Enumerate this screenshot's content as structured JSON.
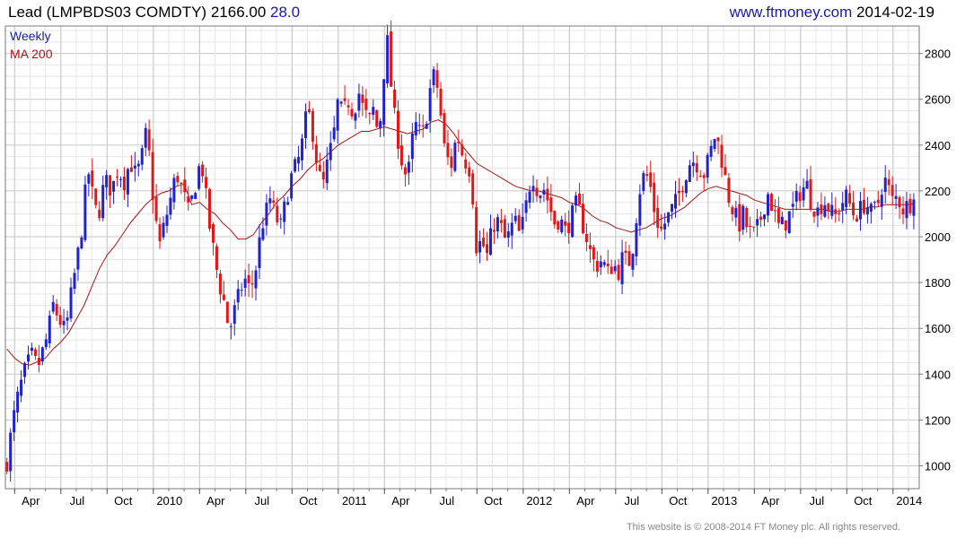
{
  "header": {
    "name": "Lead",
    "ticker": "(LMPBDS03 COMDTY)",
    "last": "2166.00",
    "change": "28.0",
    "site": "www.ftmoney.com",
    "date": "2014-02-19"
  },
  "legend": {
    "period": "Weekly",
    "ma": "MA 200"
  },
  "footer": "This website is © 2008-2014 FT Money plc. All rights reserved.",
  "colors": {
    "up": "#2222cc",
    "down": "#e01818",
    "ma": "#a21616",
    "grid_major": "#c6c6c6",
    "grid_minor": "#e6e6e6"
  },
  "chart_data": {
    "type": "candlestick",
    "ylim": [
      900,
      2920
    ],
    "yticks": [
      1000,
      1200,
      1400,
      1600,
      1800,
      2000,
      2200,
      2400,
      2600,
      2800
    ],
    "xticks": [
      {
        "label": "Apr",
        "t": 0.5
      },
      {
        "label": "Jul",
        "t": 3.5
      },
      {
        "label": "Oct",
        "t": 6.5
      },
      {
        "label": "2010",
        "t": 9.5
      },
      {
        "label": "Apr",
        "t": 12.5
      },
      {
        "label": "Jul",
        "t": 15.5
      },
      {
        "label": "Oct",
        "t": 18.5
      },
      {
        "label": "2011",
        "t": 21.5
      },
      {
        "label": "Apr",
        "t": 24.5
      },
      {
        "label": "Jul",
        "t": 27.5
      },
      {
        "label": "Oct",
        "t": 30.5
      },
      {
        "label": "2012",
        "t": 33.5
      },
      {
        "label": "Apr",
        "t": 36.5
      },
      {
        "label": "Jul",
        "t": 39.5
      },
      {
        "label": "Oct",
        "t": 42.5
      },
      {
        "label": "2013",
        "t": 45.5
      },
      {
        "label": "Apr",
        "t": 48.5
      },
      {
        "label": "Jul",
        "t": 51.5
      },
      {
        "label": "Oct",
        "t": 54.5
      },
      {
        "label": "2014",
        "t": 57.5
      }
    ],
    "x_range_months": [
      -0.1,
      59.2
    ],
    "close_path": [
      [
        0,
        1020
      ],
      [
        0.4,
        1200
      ],
      [
        0.8,
        1330
      ],
      [
        1.2,
        1420
      ],
      [
        1.6,
        1480
      ],
      [
        2.0,
        1430
      ],
      [
        2.6,
        1560
      ],
      [
        3.0,
        1700
      ],
      [
        3.4,
        1640
      ],
      [
        3.8,
        1580
      ],
      [
        4.2,
        1760
      ],
      [
        4.5,
        1880
      ],
      [
        4.8,
        2000
      ],
      [
        5.0,
        2150
      ],
      [
        5.3,
        2280
      ],
      [
        5.6,
        2160
      ],
      [
        5.9,
        2080
      ],
      [
        6.2,
        2200
      ],
      [
        6.5,
        2240
      ],
      [
        6.8,
        2200
      ],
      [
        7.2,
        2300
      ],
      [
        7.6,
        2240
      ],
      [
        8.0,
        2330
      ],
      [
        8.4,
        2260
      ],
      [
        8.8,
        2360
      ],
      [
        9.1,
        2480
      ],
      [
        9.3,
        2290
      ],
      [
        9.6,
        2100
      ],
      [
        9.9,
        1960
      ],
      [
        10.2,
        2050
      ],
      [
        10.6,
        2160
      ],
      [
        11.0,
        2280
      ],
      [
        11.4,
        2200
      ],
      [
        11.8,
        2100
      ],
      [
        12.2,
        2220
      ],
      [
        12.6,
        2340
      ],
      [
        12.9,
        2180
      ],
      [
        13.2,
        2020
      ],
      [
        13.6,
        1860
      ],
      [
        13.9,
        1760
      ],
      [
        14.2,
        1690
      ],
      [
        14.4,
        1580
      ],
      [
        14.7,
        1660
      ],
      [
        15.0,
        1730
      ],
      [
        15.4,
        1820
      ],
      [
        15.8,
        1760
      ],
      [
        16.2,
        1880
      ],
      [
        16.5,
        2040
      ],
      [
        16.8,
        2100
      ],
      [
        17.1,
        2170
      ],
      [
        17.4,
        2090
      ],
      [
        17.8,
        2040
      ],
      [
        18.1,
        2160
      ],
      [
        18.5,
        2270
      ],
      [
        18.9,
        2330
      ],
      [
        19.2,
        2420
      ],
      [
        19.5,
        2560
      ],
      [
        19.9,
        2440
      ],
      [
        20.2,
        2280
      ],
      [
        20.5,
        2220
      ],
      [
        20.8,
        2320
      ],
      [
        21.2,
        2440
      ],
      [
        21.5,
        2600
      ],
      [
        21.8,
        2520
      ],
      [
        22.1,
        2600
      ],
      [
        22.5,
        2540
      ],
      [
        22.8,
        2640
      ],
      [
        23.1,
        2560
      ],
      [
        23.5,
        2500
      ],
      [
        23.8,
        2560
      ],
      [
        24.1,
        2440
      ],
      [
        24.3,
        2560
      ],
      [
        24.5,
        2760
      ],
      [
        24.7,
        2850
      ],
      [
        24.9,
        2680
      ],
      [
        25.1,
        2540
      ],
      [
        25.4,
        2420
      ],
      [
        25.7,
        2300
      ],
      [
        26.0,
        2250
      ],
      [
        26.3,
        2420
      ],
      [
        26.6,
        2500
      ],
      [
        26.9,
        2420
      ],
      [
        27.2,
        2520
      ],
      [
        27.5,
        2660
      ],
      [
        27.8,
        2720
      ],
      [
        28.1,
        2560
      ],
      [
        28.4,
        2380
      ],
      [
        28.8,
        2300
      ],
      [
        29.2,
        2450
      ],
      [
        29.6,
        2350
      ],
      [
        30.0,
        2300
      ],
      [
        30.3,
        2140
      ],
      [
        30.5,
        1920
      ],
      [
        30.8,
        2000
      ],
      [
        31.1,
        1900
      ],
      [
        31.4,
        2000
      ],
      [
        31.7,
        2080
      ],
      [
        32.0,
        2050
      ],
      [
        32.4,
        1970
      ],
      [
        32.7,
        2040
      ],
      [
        33.0,
        2060
      ],
      [
        33.3,
        2000
      ],
      [
        33.6,
        2100
      ],
      [
        33.9,
        2220
      ],
      [
        34.2,
        2270
      ],
      [
        34.5,
        2180
      ],
      [
        34.8,
        2220
      ],
      [
        35.2,
        2140
      ],
      [
        35.5,
        2060
      ],
      [
        35.9,
        2080
      ],
      [
        36.2,
        2020
      ],
      [
        36.6,
        2080
      ],
      [
        37.0,
        2150
      ],
      [
        37.3,
        2070
      ],
      [
        37.6,
        2000
      ],
      [
        37.9,
        1920
      ],
      [
        38.2,
        1870
      ],
      [
        38.6,
        1900
      ],
      [
        39.0,
        1840
      ],
      [
        39.3,
        1880
      ],
      [
        39.7,
        1850
      ],
      [
        40.0,
        1920
      ],
      [
        40.3,
        1870
      ],
      [
        40.6,
        1950
      ],
      [
        40.8,
        2070
      ],
      [
        41.1,
        2220
      ],
      [
        41.4,
        2280
      ],
      [
        41.7,
        2240
      ],
      [
        42.0,
        2120
      ],
      [
        42.4,
        2020
      ],
      [
        42.7,
        2060
      ],
      [
        43.0,
        2100
      ],
      [
        43.4,
        2150
      ],
      [
        43.7,
        2200
      ],
      [
        44.0,
        2270
      ],
      [
        44.4,
        2340
      ],
      [
        44.8,
        2320
      ],
      [
        45.2,
        2270
      ],
      [
        45.6,
        2350
      ],
      [
        45.9,
        2440
      ],
      [
        46.2,
        2400
      ],
      [
        46.5,
        2300
      ],
      [
        46.8,
        2180
      ],
      [
        47.1,
        2120
      ],
      [
        47.5,
        2050
      ],
      [
        47.8,
        2100
      ],
      [
        48.1,
        2020
      ],
      [
        48.5,
        2010
      ],
      [
        48.8,
        2050
      ],
      [
        49.1,
        2130
      ],
      [
        49.4,
        2190
      ],
      [
        49.8,
        2100
      ],
      [
        50.1,
        2040
      ],
      [
        50.5,
        2060
      ],
      [
        50.8,
        2100
      ],
      [
        51.1,
        2140
      ],
      [
        51.5,
        2200
      ],
      [
        51.9,
        2230
      ],
      [
        52.2,
        2150
      ],
      [
        52.6,
        2110
      ],
      [
        53.0,
        2160
      ],
      [
        53.3,
        2130
      ],
      [
        53.7,
        2080
      ],
      [
        54.0,
        2120
      ],
      [
        54.4,
        2180
      ],
      [
        54.7,
        2140
      ],
      [
        55.0,
        2090
      ],
      [
        55.4,
        2120
      ],
      [
        55.7,
        2150
      ],
      [
        56.1,
        2100
      ],
      [
        56.5,
        2140
      ],
      [
        56.9,
        2260
      ],
      [
        57.2,
        2210
      ],
      [
        57.5,
        2150
      ],
      [
        57.8,
        2180
      ],
      [
        58.1,
        2120
      ],
      [
        58.5,
        2140
      ],
      [
        58.9,
        2166
      ]
    ],
    "ma200": [
      [
        0,
        1510
      ],
      [
        0.5,
        1470
      ],
      [
        1.0,
        1445
      ],
      [
        1.5,
        1440
      ],
      [
        2.0,
        1455
      ],
      [
        2.5,
        1470
      ],
      [
        3.0,
        1510
      ],
      [
        3.5,
        1540
      ],
      [
        4.0,
        1580
      ],
      [
        4.5,
        1640
      ],
      [
        5.0,
        1700
      ],
      [
        5.5,
        1780
      ],
      [
        6.0,
        1860
      ],
      [
        6.5,
        1920
      ],
      [
        7.0,
        1960
      ],
      [
        7.5,
        2010
      ],
      [
        8.0,
        2060
      ],
      [
        8.5,
        2100
      ],
      [
        9.0,
        2140
      ],
      [
        9.5,
        2170
      ],
      [
        10.0,
        2190
      ],
      [
        10.5,
        2200
      ],
      [
        11.0,
        2220
      ],
      [
        11.5,
        2230
      ],
      [
        12.0,
        2140
      ],
      [
        12.5,
        2150
      ],
      [
        13.0,
        2120
      ],
      [
        13.5,
        2100
      ],
      [
        14.0,
        2060
      ],
      [
        14.5,
        2030
      ],
      [
        15.0,
        1990
      ],
      [
        15.5,
        1990
      ],
      [
        16.0,
        2010
      ],
      [
        16.5,
        2060
      ],
      [
        17.0,
        2100
      ],
      [
        17.5,
        2150
      ],
      [
        18.0,
        2180
      ],
      [
        18.5,
        2220
      ],
      [
        19.0,
        2250
      ],
      [
        19.5,
        2290
      ],
      [
        20.0,
        2320
      ],
      [
        20.5,
        2340
      ],
      [
        21.0,
        2370
      ],
      [
        21.5,
        2400
      ],
      [
        22.0,
        2420
      ],
      [
        22.5,
        2440
      ],
      [
        23.0,
        2460
      ],
      [
        23.5,
        2460
      ],
      [
        24.0,
        2470
      ],
      [
        24.5,
        2480
      ],
      [
        25.0,
        2470
      ],
      [
        25.5,
        2460
      ],
      [
        26.0,
        2450
      ],
      [
        26.5,
        2460
      ],
      [
        27.0,
        2470
      ],
      [
        27.5,
        2500
      ],
      [
        28.0,
        2510
      ],
      [
        28.5,
        2490
      ],
      [
        29.0,
        2450
      ],
      [
        29.5,
        2400
      ],
      [
        30.0,
        2360
      ],
      [
        30.5,
        2320
      ],
      [
        31.0,
        2300
      ],
      [
        31.5,
        2280
      ],
      [
        32.0,
        2260
      ],
      [
        32.5,
        2240
      ],
      [
        33.0,
        2220
      ],
      [
        33.5,
        2210
      ],
      [
        34.0,
        2200
      ],
      [
        34.5,
        2200
      ],
      [
        35.0,
        2190
      ],
      [
        35.5,
        2180
      ],
      [
        36.0,
        2170
      ],
      [
        36.5,
        2150
      ],
      [
        37.0,
        2140
      ],
      [
        37.5,
        2120
      ],
      [
        38.0,
        2090
      ],
      [
        38.5,
        2070
      ],
      [
        39.0,
        2060
      ],
      [
        39.5,
        2040
      ],
      [
        40.0,
        2030
      ],
      [
        40.5,
        2020
      ],
      [
        41.0,
        2030
      ],
      [
        41.5,
        2040
      ],
      [
        42.0,
        2060
      ],
      [
        42.5,
        2080
      ],
      [
        43.0,
        2090
      ],
      [
        43.5,
        2110
      ],
      [
        44.0,
        2130
      ],
      [
        44.5,
        2160
      ],
      [
        45.0,
        2190
      ],
      [
        45.5,
        2210
      ],
      [
        46.0,
        2220
      ],
      [
        46.5,
        2210
      ],
      [
        47.0,
        2200
      ],
      [
        47.5,
        2190
      ],
      [
        48.0,
        2180
      ],
      [
        48.5,
        2160
      ],
      [
        49.0,
        2150
      ],
      [
        49.5,
        2140
      ],
      [
        50.0,
        2130
      ],
      [
        50.5,
        2120
      ],
      [
        51.0,
        2120
      ],
      [
        51.5,
        2120
      ],
      [
        52.0,
        2120
      ],
      [
        52.5,
        2120
      ],
      [
        53.0,
        2120
      ],
      [
        53.5,
        2110
      ],
      [
        54.0,
        2110
      ],
      [
        54.5,
        2120
      ],
      [
        55.0,
        2120
      ],
      [
        55.5,
        2120
      ],
      [
        56.0,
        2130
      ],
      [
        56.5,
        2130
      ],
      [
        57.0,
        2140
      ],
      [
        57.5,
        2140
      ],
      [
        58.0,
        2140
      ],
      [
        58.5,
        2140
      ],
      [
        58.9,
        2145
      ]
    ]
  }
}
